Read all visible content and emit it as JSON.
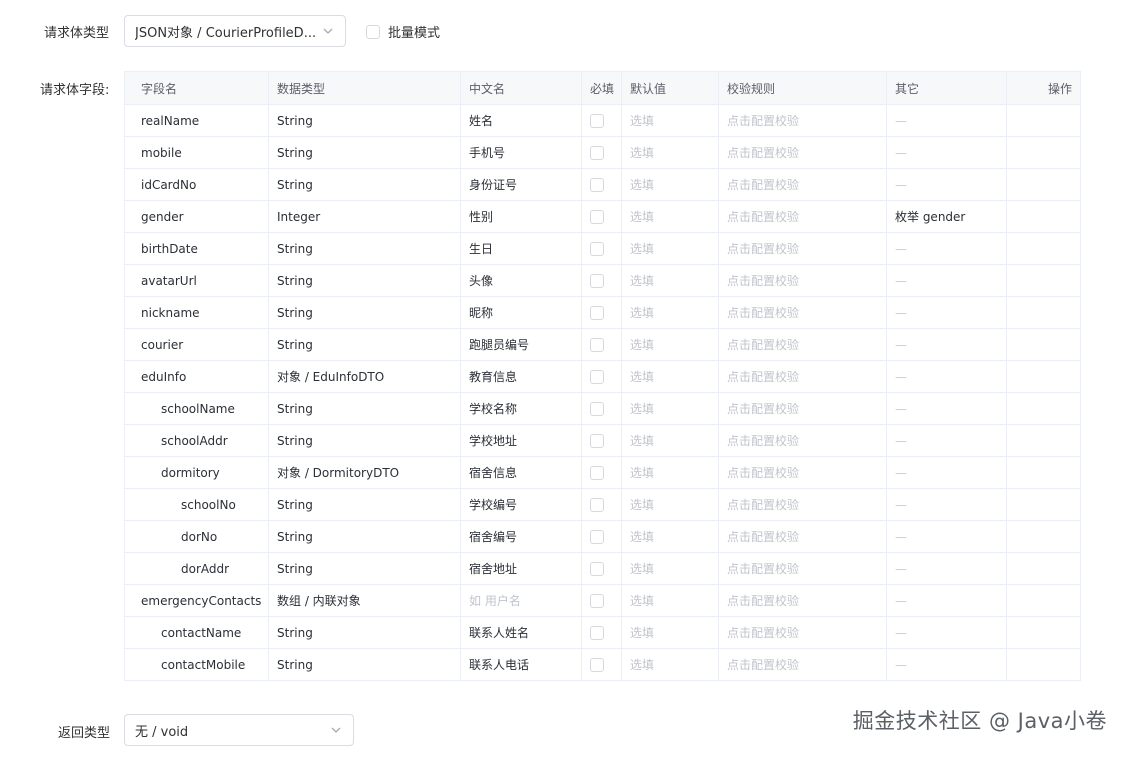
{
  "request_body_type": {
    "label": "请求体类型",
    "value": "JSON对象 / CourierProfileD...",
    "batch_mode_label": "批量模式"
  },
  "fields_section": {
    "label": "请求体字段:",
    "headers": [
      "字段名",
      "数据类型",
      "中文名",
      "必填",
      "默认值",
      "校验规则",
      "其它",
      "操作"
    ],
    "rows": [
      {
        "name": "realName",
        "indent": 0,
        "type": "String",
        "cn": "姓名",
        "default": "选填",
        "rule": "点击配置校验",
        "other": "—"
      },
      {
        "name": "mobile",
        "indent": 0,
        "type": "String",
        "cn": "手机号",
        "default": "选填",
        "rule": "点击配置校验",
        "other": "—"
      },
      {
        "name": "idCardNo",
        "indent": 0,
        "type": "String",
        "cn": "身份证号",
        "default": "选填",
        "rule": "点击配置校验",
        "other": "—"
      },
      {
        "name": "gender",
        "indent": 0,
        "type": "Integer",
        "cn": "性别",
        "default": "选填",
        "rule": "点击配置校验",
        "other": "枚举 gender"
      },
      {
        "name": "birthDate",
        "indent": 0,
        "type": "String",
        "cn": "生日",
        "default": "选填",
        "rule": "点击配置校验",
        "other": "—"
      },
      {
        "name": "avatarUrl",
        "indent": 0,
        "type": "String",
        "cn": "头像",
        "default": "选填",
        "rule": "点击配置校验",
        "other": "—"
      },
      {
        "name": "nickname",
        "indent": 0,
        "type": "String",
        "cn": "昵称",
        "default": "选填",
        "rule": "点击配置校验",
        "other": "—"
      },
      {
        "name": "courier",
        "indent": 0,
        "type": "String",
        "cn": "跑腿员编号",
        "default": "选填",
        "rule": "点击配置校验",
        "other": "—"
      },
      {
        "name": "eduInfo",
        "indent": 0,
        "type": "对象 / EduInfoDTO",
        "cn": "教育信息",
        "default": "选填",
        "rule": "点击配置校验",
        "other": "—"
      },
      {
        "name": "schoolName",
        "indent": 1,
        "type": "String",
        "cn": "学校名称",
        "default": "选填",
        "rule": "点击配置校验",
        "other": "—"
      },
      {
        "name": "schoolAddr",
        "indent": 1,
        "type": "String",
        "cn": "学校地址",
        "default": "选填",
        "rule": "点击配置校验",
        "other": "—"
      },
      {
        "name": "dormitory",
        "indent": 1,
        "type": "对象 / DormitoryDTO",
        "cn": "宿舍信息",
        "default": "选填",
        "rule": "点击配置校验",
        "other": "—"
      },
      {
        "name": "schoolNo",
        "indent": 2,
        "type": "String",
        "cn": "学校编号",
        "default": "选填",
        "rule": "点击配置校验",
        "other": "—"
      },
      {
        "name": "dorNo",
        "indent": 2,
        "type": "String",
        "cn": "宿舍编号",
        "default": "选填",
        "rule": "点击配置校验",
        "other": "—"
      },
      {
        "name": "dorAddr",
        "indent": 2,
        "type": "String",
        "cn": "宿舍地址",
        "default": "选填",
        "rule": "点击配置校验",
        "other": "—"
      },
      {
        "name": "emergencyContacts",
        "indent": 0,
        "type": "数组 / 内联对象",
        "cn": "如 用户名",
        "cn_placeholder": true,
        "default": "选填",
        "rule": "点击配置校验",
        "other": "—"
      },
      {
        "name": "contactName",
        "indent": 1,
        "type": "String",
        "cn": "联系人姓名",
        "default": "选填",
        "rule": "点击配置校验",
        "other": "—"
      },
      {
        "name": "contactMobile",
        "indent": 1,
        "type": "String",
        "cn": "联系人电话",
        "default": "选填",
        "rule": "点击配置校验",
        "other": "—"
      }
    ]
  },
  "return_type": {
    "label": "返回类型",
    "value": "无 / void"
  },
  "watermark": "掘金技术社区 @ Java小卷",
  "icons": {
    "select_arrow": "chevron-down-icon"
  },
  "colors": {
    "border": "#ebeef5",
    "header_bg": "#f7f8fa",
    "placeholder": "#c0c4cc"
  }
}
